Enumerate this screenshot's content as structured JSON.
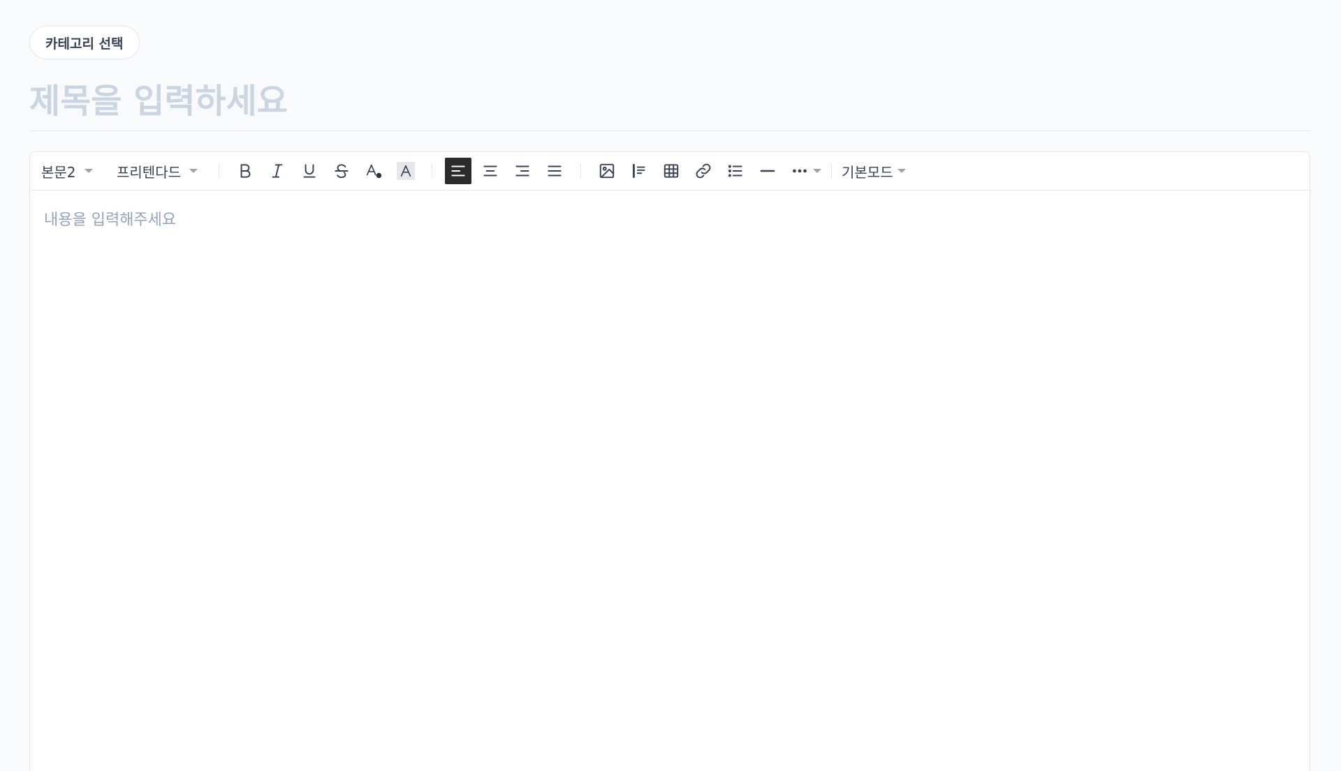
{
  "category": {
    "label": "카테고리 선택"
  },
  "title": {
    "placeholder": "제목을 입력하세요",
    "value": ""
  },
  "toolbar": {
    "paragraph_style": "본문2",
    "font_family": "프리텐다드",
    "mode": "기본모드",
    "text_color_dot": "#333333",
    "active_align": "left",
    "icons": [
      "bold-icon",
      "italic-icon",
      "underline-icon",
      "strikethrough-icon",
      "text-color-icon",
      "text-background-icon",
      "align-left-icon",
      "align-center-icon",
      "align-right-icon",
      "align-justify-icon",
      "image-icon",
      "quote-icon",
      "table-icon",
      "link-icon",
      "list-icon",
      "horizontal-rule-icon",
      "more-icon"
    ]
  },
  "editor": {
    "placeholder": "내용을 입력해주세요",
    "value": ""
  },
  "colors": {
    "background": "#f8fafc",
    "active_button": "#2b2b2b",
    "placeholder_title": "#cbd5e1",
    "placeholder_body": "#94a3b8",
    "border": "#e5e7eb"
  }
}
